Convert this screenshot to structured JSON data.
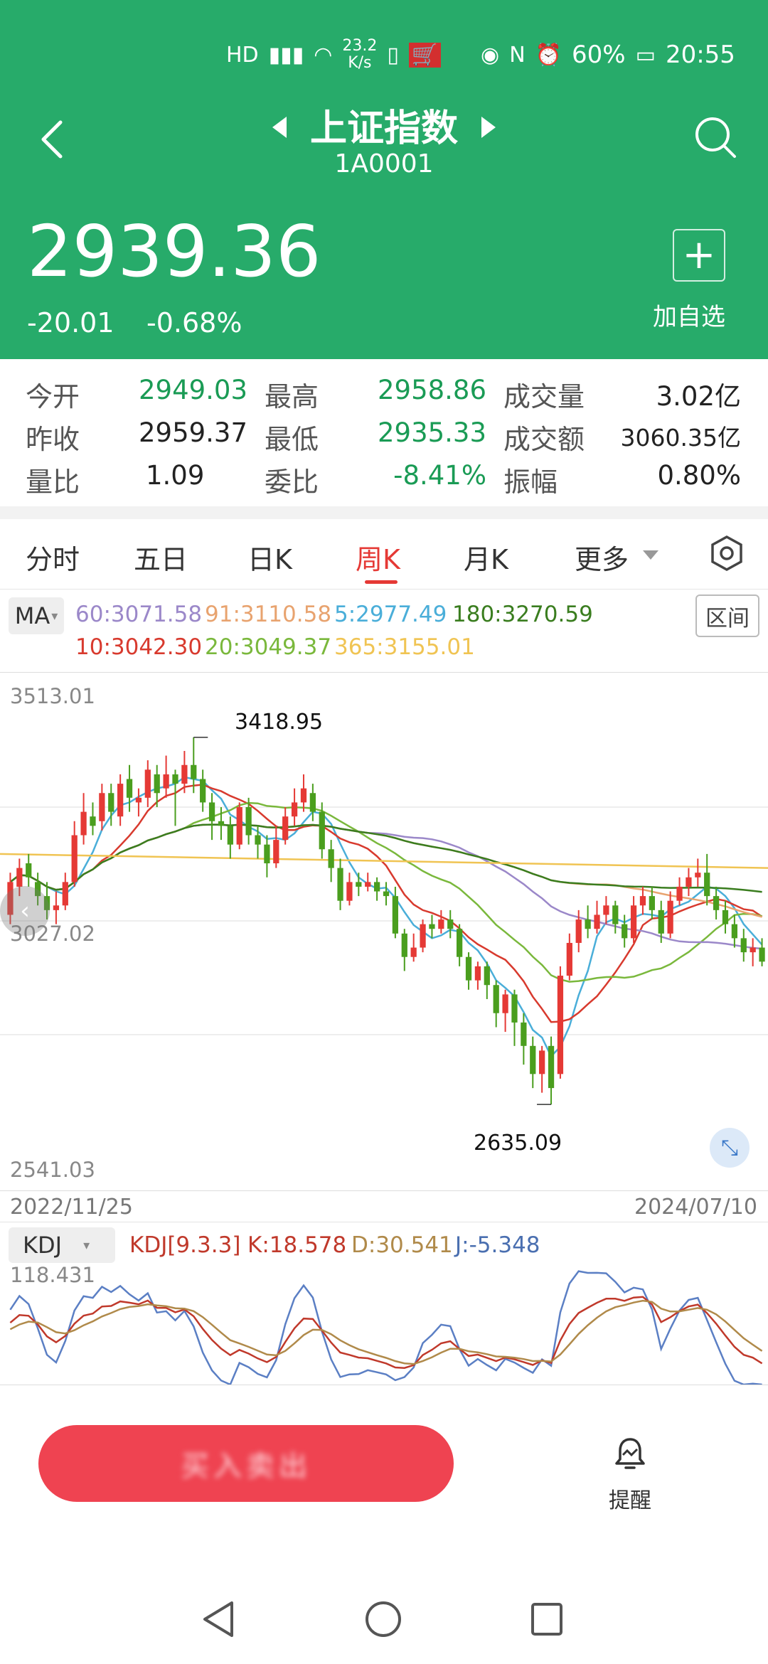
{
  "status_bar": {
    "net_speed_top": "23.2",
    "net_speed_bottom": "K/s",
    "battery": "60%",
    "time": "20:55"
  },
  "header": {
    "title": "上证指数",
    "code": "1A0001",
    "price": "2939.36",
    "change": "-20.01",
    "change_pct": "-0.68%",
    "add_label": "加自选",
    "add_symbol": "+"
  },
  "stats": [
    {
      "label": "今开",
      "value": "2949.03",
      "color": "green"
    },
    {
      "label": "最高",
      "value": "2958.86",
      "color": "green"
    },
    {
      "label": "成交量",
      "value": "3.02亿",
      "color": "dark"
    },
    {
      "label": "昨收",
      "value": "2959.37",
      "color": "dark"
    },
    {
      "label": "最低",
      "value": "2935.33",
      "color": "green"
    },
    {
      "label": "成交额",
      "value": "3060.35亿",
      "color": "dark"
    },
    {
      "label": "量比",
      "value": "1.09",
      "color": "dark"
    },
    {
      "label": "委比",
      "value": "-8.41%",
      "color": "green"
    },
    {
      "label": "振幅",
      "value": "0.80%",
      "color": "dark"
    }
  ],
  "tabs": [
    "分时",
    "五日",
    "日K",
    "周K",
    "月K",
    "更多"
  ],
  "active_tab": 3,
  "ma": {
    "button": "MA",
    "range_button": "区间",
    "row1": [
      {
        "text": "60:3071.58",
        "color": "#9b88c9"
      },
      {
        "text": "91:3110.58",
        "color": "#e8a36f"
      },
      {
        "text": "5:2977.49",
        "color": "#4aaed9"
      },
      {
        "text": "180:3270.59",
        "color": "#3a7d1f"
      }
    ],
    "row2": [
      {
        "text": "10:3042.30",
        "color": "#d83a2e"
      },
      {
        "text": "20:3049.37",
        "color": "#7ab83c"
      },
      {
        "text": "365:3155.01",
        "color": "#f0c453"
      }
    ]
  },
  "chart_data": {
    "type": "candlestick",
    "y_top_label": "3513.01",
    "y_mid_label": "3027.02",
    "y_bottom_label": "2541.03",
    "x_start": "2022/11/25",
    "x_end": "2024/07/10",
    "high_annotation": "3418.95",
    "low_annotation": "2635.09",
    "candles": [
      {
        "o": 3040,
        "c": 3110,
        "h": 3130,
        "l": 3020
      },
      {
        "o": 3100,
        "c": 3140,
        "h": 3160,
        "l": 3080
      },
      {
        "o": 3150,
        "c": 3120,
        "h": 3170,
        "l": 3100
      },
      {
        "o": 3110,
        "c": 3080,
        "h": 3130,
        "l": 3060
      },
      {
        "o": 3080,
        "c": 3050,
        "h": 3110,
        "l": 3030
      },
      {
        "o": 3050,
        "c": 3060,
        "h": 3090,
        "l": 3020
      },
      {
        "o": 3060,
        "c": 3110,
        "h": 3130,
        "l": 3050
      },
      {
        "o": 3110,
        "c": 3210,
        "h": 3240,
        "l": 3100
      },
      {
        "o": 3210,
        "c": 3260,
        "h": 3300,
        "l": 3190
      },
      {
        "o": 3250,
        "c": 3230,
        "h": 3280,
        "l": 3210
      },
      {
        "o": 3240,
        "c": 3300,
        "h": 3320,
        "l": 3220
      },
      {
        "o": 3300,
        "c": 3260,
        "h": 3320,
        "l": 3230
      },
      {
        "o": 3250,
        "c": 3320,
        "h": 3340,
        "l": 3230
      },
      {
        "o": 3330,
        "c": 3290,
        "h": 3360,
        "l": 3260
      },
      {
        "o": 3280,
        "c": 3290,
        "h": 3310,
        "l": 3250
      },
      {
        "o": 3290,
        "c": 3350,
        "h": 3370,
        "l": 3270
      },
      {
        "o": 3340,
        "c": 3300,
        "h": 3360,
        "l": 3270
      },
      {
        "o": 3310,
        "c": 3340,
        "h": 3380,
        "l": 3290
      },
      {
        "o": 3340,
        "c": 3320,
        "h": 3350,
        "l": 3230
      },
      {
        "o": 3320,
        "c": 3360,
        "h": 3390,
        "l": 3300
      },
      {
        "o": 3360,
        "c": 3330,
        "h": 3419,
        "l": 3300
      },
      {
        "o": 3330,
        "c": 3280,
        "h": 3350,
        "l": 3260
      },
      {
        "o": 3280,
        "c": 3240,
        "h": 3300,
        "l": 3200
      },
      {
        "o": 3240,
        "c": 3230,
        "h": 3270,
        "l": 3200
      },
      {
        "o": 3230,
        "c": 3190,
        "h": 3250,
        "l": 3160
      },
      {
        "o": 3190,
        "c": 3270,
        "h": 3280,
        "l": 3180
      },
      {
        "o": 3270,
        "c": 3210,
        "h": 3290,
        "l": 3190
      },
      {
        "o": 3210,
        "c": 3190,
        "h": 3230,
        "l": 3160
      },
      {
        "o": 3190,
        "c": 3150,
        "h": 3210,
        "l": 3120
      },
      {
        "o": 3150,
        "c": 3200,
        "h": 3230,
        "l": 3140
      },
      {
        "o": 3200,
        "c": 3250,
        "h": 3270,
        "l": 3190
      },
      {
        "o": 3250,
        "c": 3280,
        "h": 3310,
        "l": 3230
      },
      {
        "o": 3280,
        "c": 3310,
        "h": 3340,
        "l": 3260
      },
      {
        "o": 3300,
        "c": 3260,
        "h": 3320,
        "l": 3240
      },
      {
        "o": 3260,
        "c": 3180,
        "h": 3280,
        "l": 3160
      },
      {
        "o": 3180,
        "c": 3140,
        "h": 3200,
        "l": 3110
      },
      {
        "o": 3140,
        "c": 3070,
        "h": 3160,
        "l": 3050
      },
      {
        "o": 3070,
        "c": 3110,
        "h": 3130,
        "l": 3060
      },
      {
        "o": 3110,
        "c": 3100,
        "h": 3130,
        "l": 3080
      },
      {
        "o": 3100,
        "c": 3110,
        "h": 3130,
        "l": 3090
      },
      {
        "o": 3110,
        "c": 3090,
        "h": 3120,
        "l": 3070
      },
      {
        "o": 3090,
        "c": 3080,
        "h": 3110,
        "l": 3060
      },
      {
        "o": 3080,
        "c": 3000,
        "h": 3100,
        "l": 2990
      },
      {
        "o": 3000,
        "c": 2950,
        "h": 3010,
        "l": 2920
      },
      {
        "o": 2950,
        "c": 2970,
        "h": 3000,
        "l": 2940
      },
      {
        "o": 2970,
        "c": 3020,
        "h": 3030,
        "l": 2960
      },
      {
        "o": 3020,
        "c": 3010,
        "h": 3040,
        "l": 2990
      },
      {
        "o": 3010,
        "c": 3030,
        "h": 3050,
        "l": 3000
      },
      {
        "o": 3030,
        "c": 3010,
        "h": 3050,
        "l": 2990
      },
      {
        "o": 3010,
        "c": 2950,
        "h": 3020,
        "l": 2930
      },
      {
        "o": 2950,
        "c": 2900,
        "h": 2960,
        "l": 2880
      },
      {
        "o": 2900,
        "c": 2930,
        "h": 2940,
        "l": 2880
      },
      {
        "o": 2930,
        "c": 2890,
        "h": 2940,
        "l": 2860
      },
      {
        "o": 2890,
        "c": 2830,
        "h": 2900,
        "l": 2800
      },
      {
        "o": 2830,
        "c": 2870,
        "h": 2880,
        "l": 2790
      },
      {
        "o": 2870,
        "c": 2810,
        "h": 2880,
        "l": 2760
      },
      {
        "o": 2810,
        "c": 2760,
        "h": 2830,
        "l": 2720
      },
      {
        "o": 2760,
        "c": 2700,
        "h": 2780,
        "l": 2670
      },
      {
        "o": 2700,
        "c": 2750,
        "h": 2760,
        "l": 2660
      },
      {
        "o": 2760,
        "c": 2670,
        "h": 2780,
        "l": 2635
      },
      {
        "o": 2700,
        "c": 2910,
        "h": 2930,
        "l": 2690
      },
      {
        "o": 2910,
        "c": 2980,
        "h": 3000,
        "l": 2900
      },
      {
        "o": 2980,
        "c": 3030,
        "h": 3050,
        "l": 2960
      },
      {
        "o": 3030,
        "c": 3010,
        "h": 3060,
        "l": 2990
      },
      {
        "o": 3010,
        "c": 3040,
        "h": 3070,
        "l": 3000
      },
      {
        "o": 3040,
        "c": 3060,
        "h": 3080,
        "l": 3020
      },
      {
        "o": 3060,
        "c": 3020,
        "h": 3070,
        "l": 3000
      },
      {
        "o": 3020,
        "c": 2990,
        "h": 3040,
        "l": 2970
      },
      {
        "o": 2990,
        "c": 3060,
        "h": 3080,
        "l": 2980
      },
      {
        "o": 3060,
        "c": 3080,
        "h": 3100,
        "l": 3040
      },
      {
        "o": 3080,
        "c": 3050,
        "h": 3100,
        "l": 3030
      },
      {
        "o": 3050,
        "c": 3000,
        "h": 3070,
        "l": 2980
      },
      {
        "o": 3000,
        "c": 3070,
        "h": 3090,
        "l": 2990
      },
      {
        "o": 3070,
        "c": 3100,
        "h": 3120,
        "l": 3060
      },
      {
        "o": 3100,
        "c": 3120,
        "h": 3140,
        "l": 3080
      },
      {
        "o": 3120,
        "c": 3130,
        "h": 3160,
        "l": 3100
      },
      {
        "o": 3130,
        "c": 3080,
        "h": 3170,
        "l": 3060
      },
      {
        "o": 3080,
        "c": 3050,
        "h": 3100,
        "l": 3030
      },
      {
        "o": 3050,
        "c": 3020,
        "h": 3070,
        "l": 3000
      },
      {
        "o": 3020,
        "c": 2990,
        "h": 3040,
        "l": 2970
      },
      {
        "o": 2990,
        "c": 2960,
        "h": 3010,
        "l": 2940
      },
      {
        "o": 2960,
        "c": 2970,
        "h": 2990,
        "l": 2930
      },
      {
        "o": 2970,
        "c": 2940,
        "h": 2990,
        "l": 2930
      }
    ]
  },
  "kdj": {
    "button": "KDJ",
    "params": "KDJ[9.3.3]",
    "k": "K:18.578",
    "d": "D:30.541",
    "j": "J:-5.348",
    "top_label": "118.431"
  },
  "bottom": {
    "remind_label": "提醒",
    "button_blur": "买入卖出"
  },
  "colors": {
    "header_green": "#27ab6a",
    "rise_red": "#e53935",
    "fall_green": "#4a9e1e",
    "accent_red": "#ef4351"
  }
}
